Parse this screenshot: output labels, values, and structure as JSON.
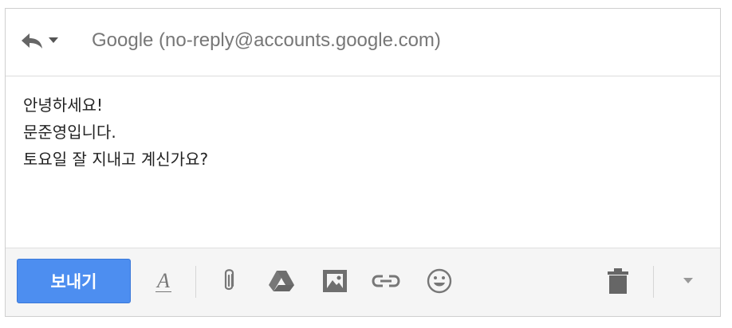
{
  "header": {
    "reply_icon": "reply-icon",
    "reply_menu_icon": "chevron-down-icon",
    "from": "Google (no-reply@accounts.google.com)"
  },
  "body": {
    "lines": [
      "안녕하세요!",
      "문준영입니다.",
      "토요일 잘 지내고 계신가요?"
    ]
  },
  "toolbar": {
    "send_label": "보내기",
    "send_color": "#4d8ef0",
    "format_label": "A",
    "icons": [
      "format-text-icon",
      "paperclip-icon",
      "drive-icon",
      "image-icon",
      "link-icon",
      "emoji-icon",
      "trash-icon",
      "more-options-icon"
    ]
  }
}
